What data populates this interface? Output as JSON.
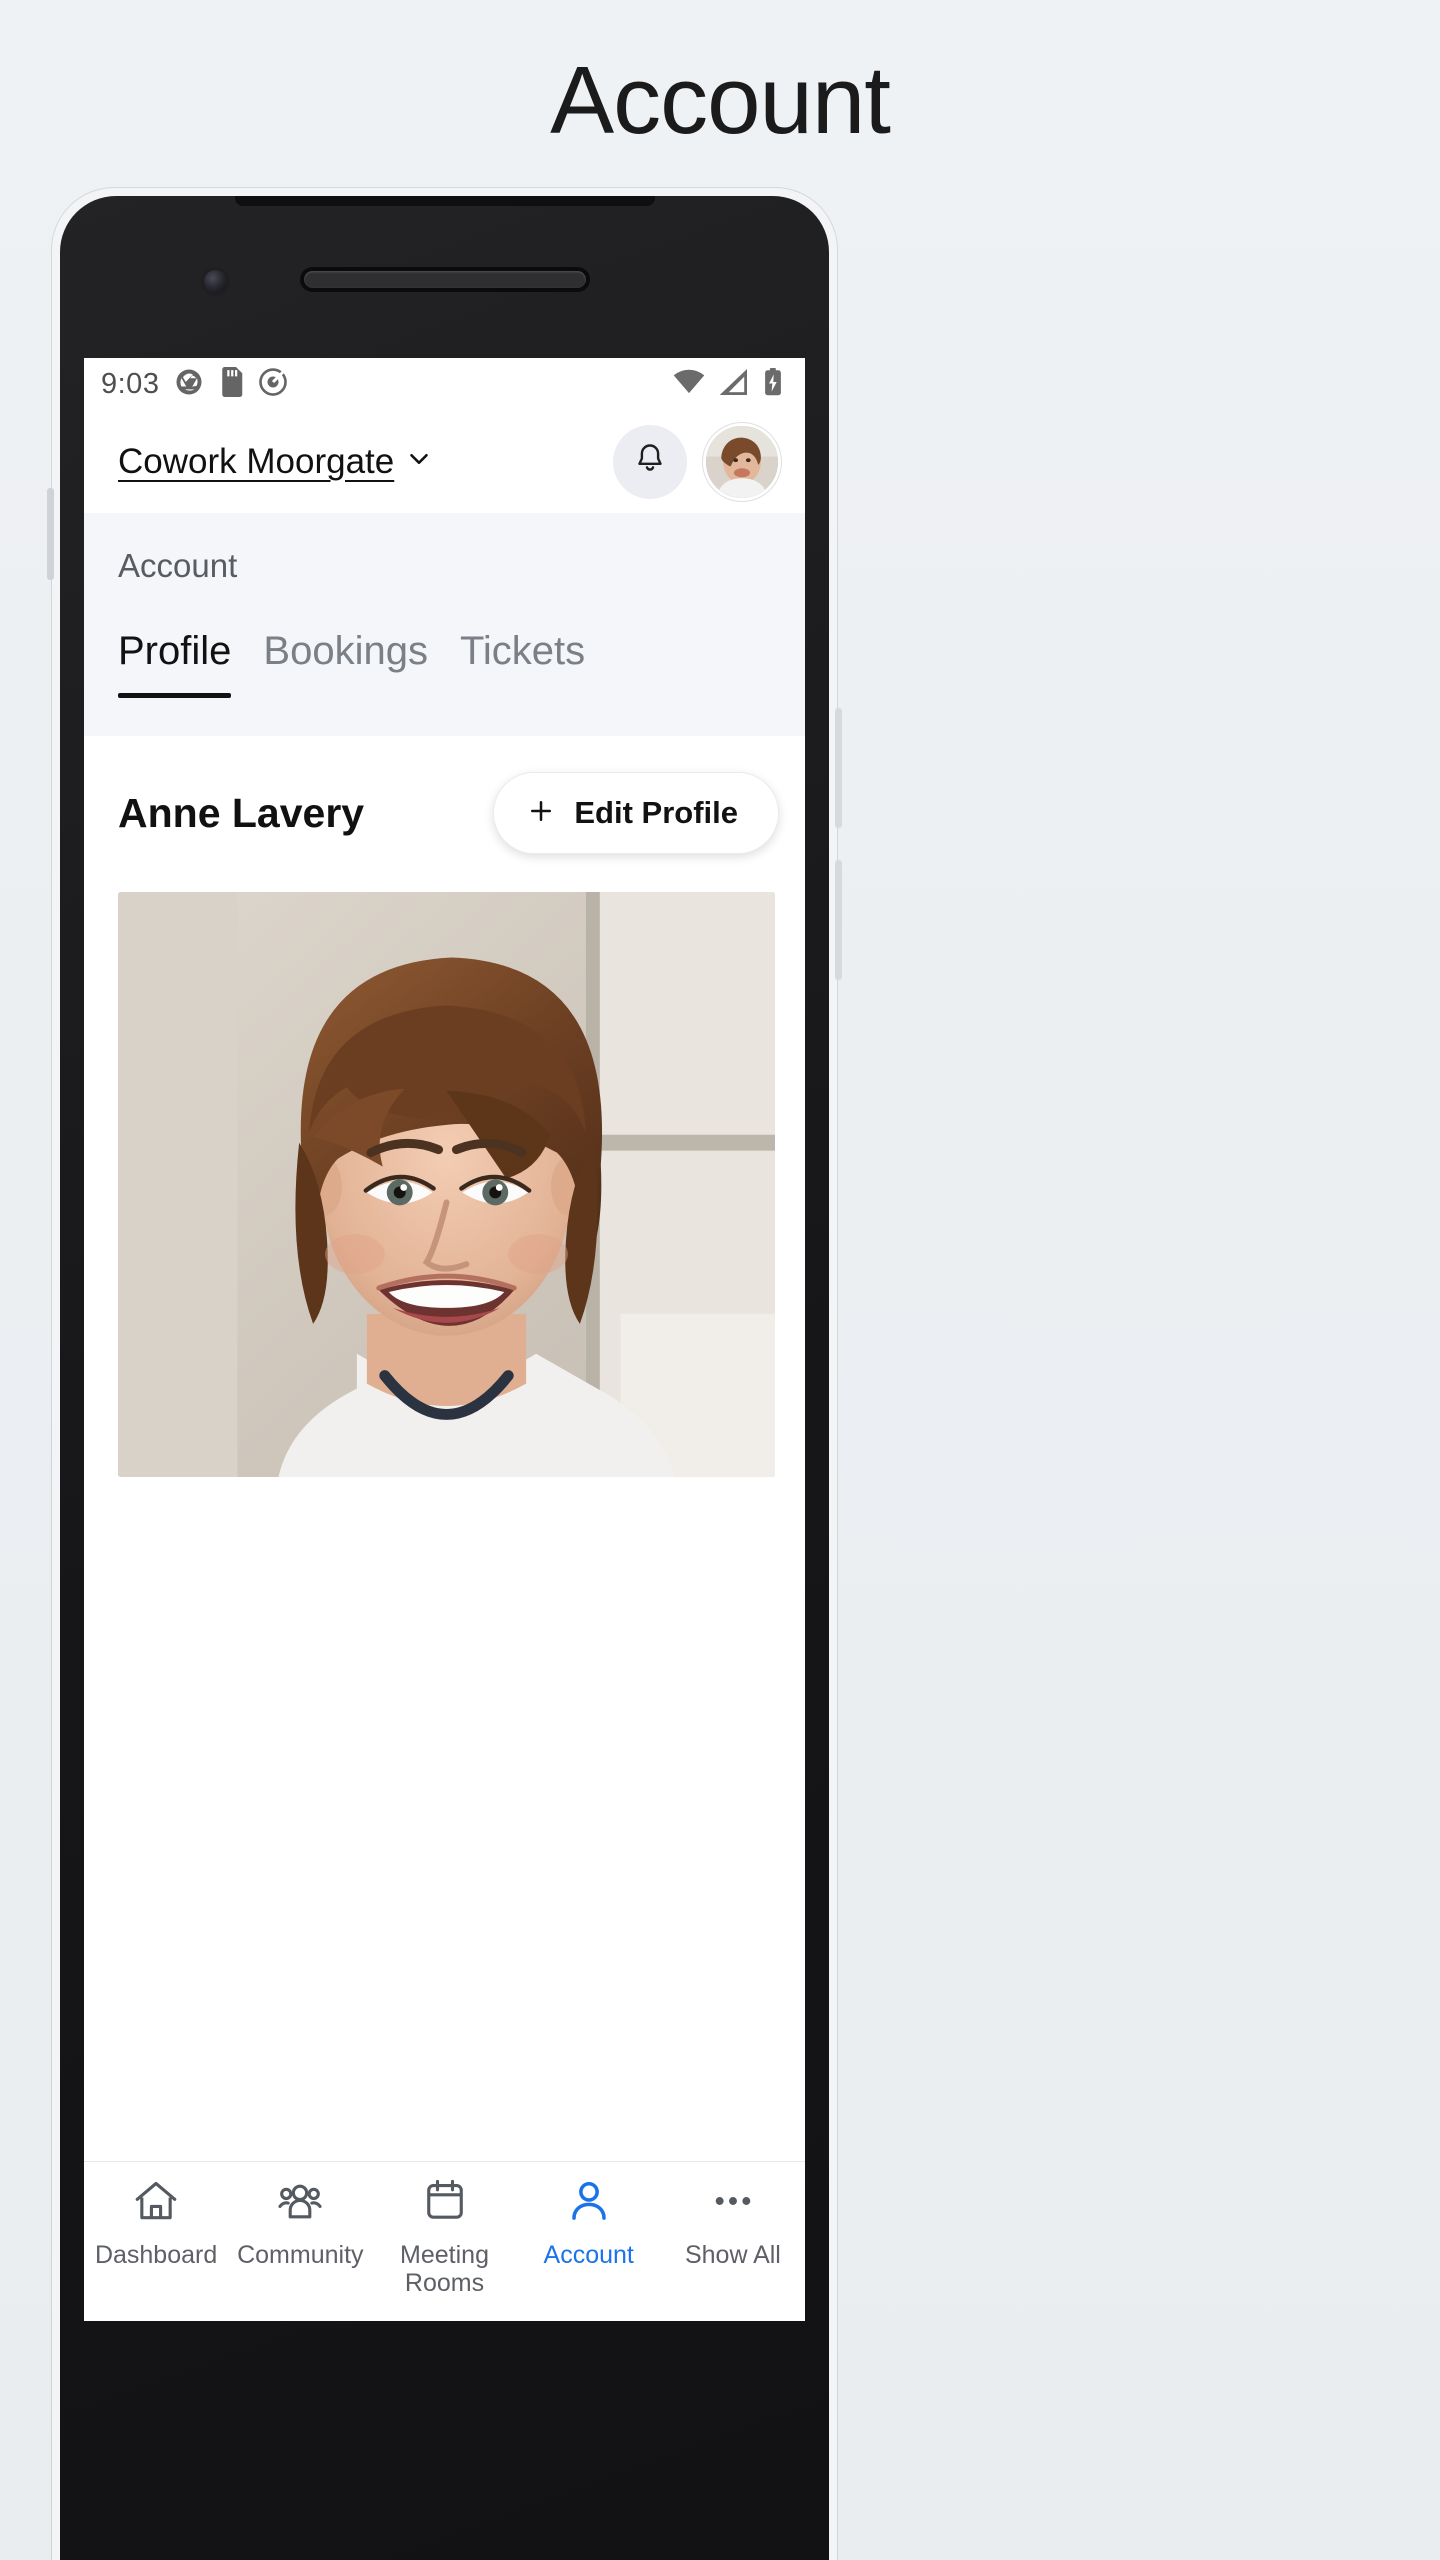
{
  "page": {
    "heading": "Account"
  },
  "status_bar": {
    "time": "9:03",
    "left_icons": [
      "shutter-icon",
      "sd-card-icon",
      "target-icon"
    ],
    "right_icons": [
      "wifi-icon",
      "cellular-signal-icon",
      "battery-charging-icon"
    ]
  },
  "app_bar": {
    "location_name": "Cowork Moorgate",
    "location_chevron": "chevron-down-icon",
    "notifications_icon": "bell-icon",
    "avatar": "user-avatar"
  },
  "section": {
    "title": "Account",
    "tabs": [
      {
        "label": "Profile",
        "active": true
      },
      {
        "label": "Bookings",
        "active": false
      },
      {
        "label": "Tickets",
        "active": false
      }
    ]
  },
  "profile": {
    "name": "Anne Lavery",
    "edit_button": {
      "label": "Edit Profile",
      "icon": "plus-icon"
    },
    "photo_alt": "profile-photo"
  },
  "bottom_nav": {
    "active_color": "#1a73e8",
    "items": [
      {
        "label": "Dashboard",
        "icon": "home-icon",
        "active": false
      },
      {
        "label": "Community",
        "icon": "people-icon",
        "active": false
      },
      {
        "label": "Meeting Rooms",
        "icon": "calendar-icon",
        "active": false
      },
      {
        "label": "Account",
        "icon": "person-icon",
        "active": true
      },
      {
        "label": "Show All",
        "icon": "ellipsis-icon",
        "active": false
      }
    ]
  },
  "colors": {
    "background": "#eef1f4",
    "screen_bg": "#ffffff",
    "section_bg": "#f4f6f9",
    "accent": "#1a73e8",
    "text_primary": "#121212",
    "text_muted": "#7b7f86"
  }
}
